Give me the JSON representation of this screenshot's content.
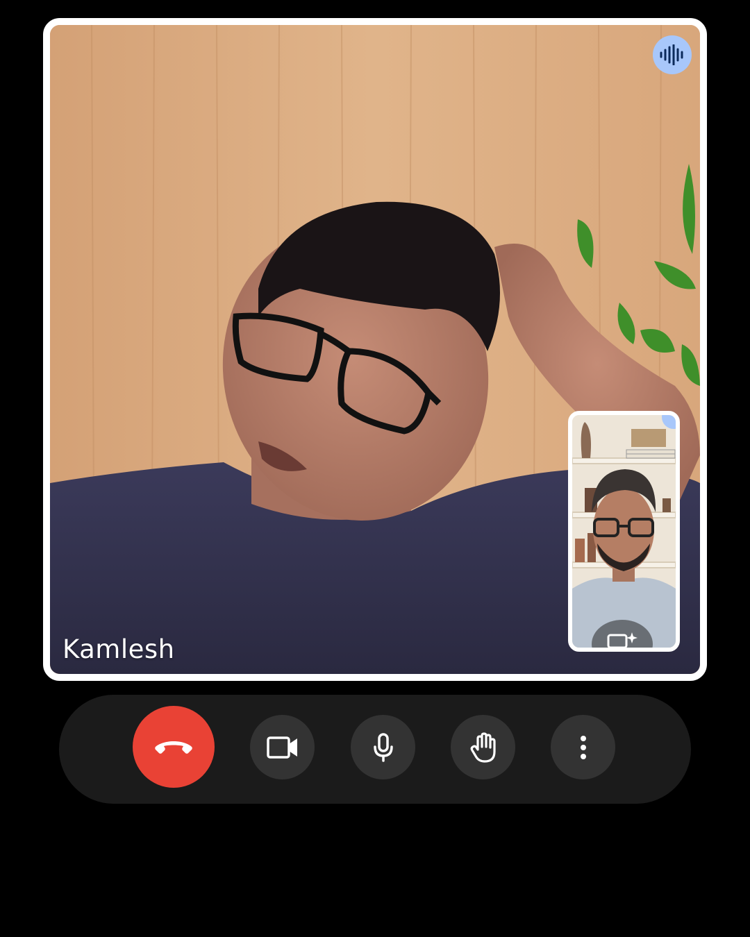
{
  "call": {
    "participant_name": "Kamlesh",
    "is_speaking": true
  },
  "controls": {
    "end_call": {
      "icon": "phone-hangup-icon",
      "color": "#e94235"
    },
    "camera": {
      "icon": "videocam-icon"
    },
    "microphone": {
      "icon": "mic-icon"
    },
    "raise_hand": {
      "icon": "hand-icon"
    },
    "more": {
      "icon": "more-vert-icon"
    }
  },
  "self_view": {
    "effects_icon": "camera-sparkle-icon"
  },
  "colors": {
    "background": "#000000",
    "control_bar": "#1b1b1b",
    "button": "#333333",
    "end_call": "#e94235",
    "speaking_indicator": "#a8c7fa",
    "tile_border": "#ffffff"
  }
}
